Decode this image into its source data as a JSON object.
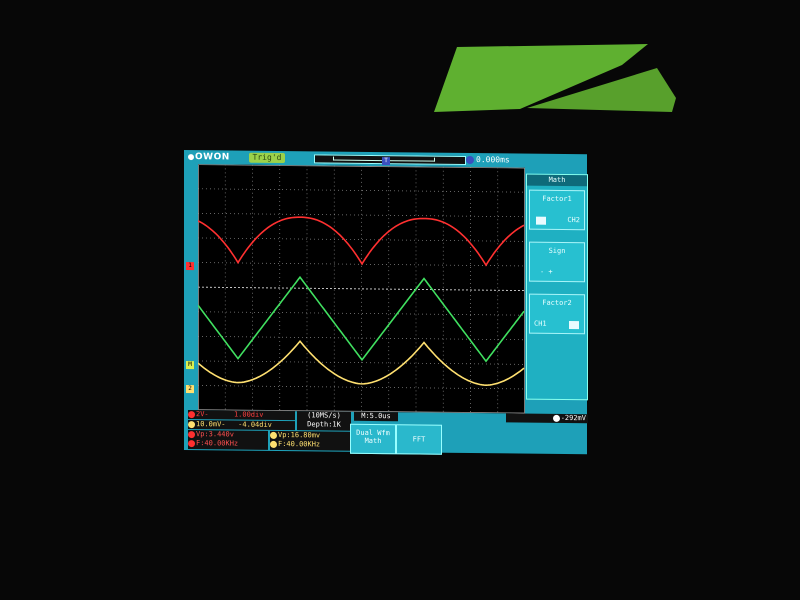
{
  "header": {
    "brand": "OWON",
    "trigger_state": "Trig'd",
    "time_position": "0.000ms"
  },
  "markers": {
    "ch1": "1",
    "ch2": "2",
    "math": "M",
    "trigger_top": "T"
  },
  "menu": {
    "title": "Math",
    "factor1": {
      "label": "Factor1",
      "value": "CH2"
    },
    "sign": {
      "label": "Sign",
      "value": "- +"
    },
    "factor2": {
      "label": "Factor2",
      "value": "CH1"
    }
  },
  "status": {
    "ch1_volts": "2V-",
    "ch1_pos": "1.00div",
    "ch2_volts": "10.0mV-",
    "ch2_pos": "-4.04div",
    "sample_rate": "(10MS/s)",
    "depth": "Depth:1K",
    "timebase": "M:5.0us",
    "trigger_level": "-292mV",
    "ch1_vp": "Vp:3.440v",
    "ch2_vp": "Vp:16.80mv",
    "ch1_freq": "F:40.00KHz",
    "ch2_freq": "F:40.00KHz"
  },
  "softkeys": {
    "dual_wfm_math": "Dual Wfm Math",
    "fft": "FFT"
  },
  "colors": {
    "ch1": "#ff3030",
    "ch2": "#ffe070",
    "math": "#40e060",
    "bezel": "#1ea0b8",
    "grid": "#8a8a8a"
  }
}
